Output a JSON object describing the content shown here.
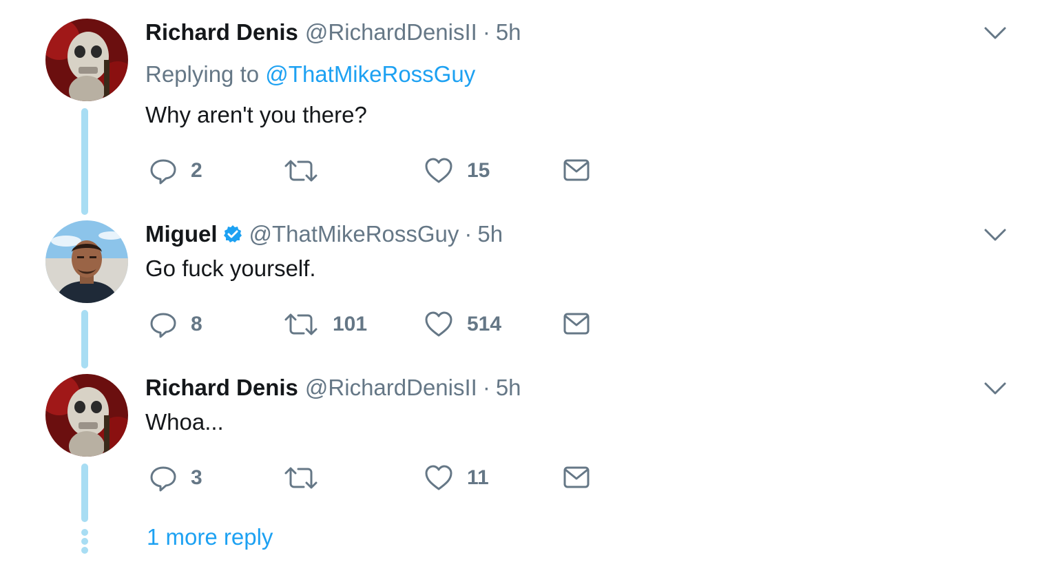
{
  "tweets": [
    {
      "display_name": "Richard Denis",
      "handle": "@RichardDenisII",
      "separator": "·",
      "time": "5h",
      "replying_prefix": "Replying to",
      "replying_mention": "@ThatMikeRossGuy",
      "text": "Why aren't you there?",
      "verified": false,
      "avatar": "skull-statue-avatar",
      "reply_count": "2",
      "retweet_count": "",
      "like_count": "15"
    },
    {
      "display_name": "Miguel",
      "handle": "@ThatMikeRossGuy",
      "separator": "·",
      "time": "5h",
      "text": "Go fuck yourself.",
      "verified": true,
      "avatar": "man-portrait-avatar",
      "reply_count": "8",
      "retweet_count": "101",
      "like_count": "514"
    },
    {
      "display_name": "Richard Denis",
      "handle": "@RichardDenisII",
      "separator": "·",
      "time": "5h",
      "text": "Whoa...",
      "verified": false,
      "avatar": "skull-statue-avatar",
      "reply_count": "3",
      "retweet_count": "",
      "like_count": "11"
    }
  ],
  "more_replies_label": "1 more reply",
  "colors": {
    "text": "#14171a",
    "muted": "#657786",
    "link": "#1da1f2",
    "thread_line": "#a8ddf3",
    "verified": "#1da1f2"
  },
  "icons": {
    "reply": "reply-icon",
    "retweet": "retweet-icon",
    "like": "heart-icon",
    "direct_message": "envelope-icon",
    "more": "chevron-down-icon",
    "verified": "verified-badge-icon"
  }
}
